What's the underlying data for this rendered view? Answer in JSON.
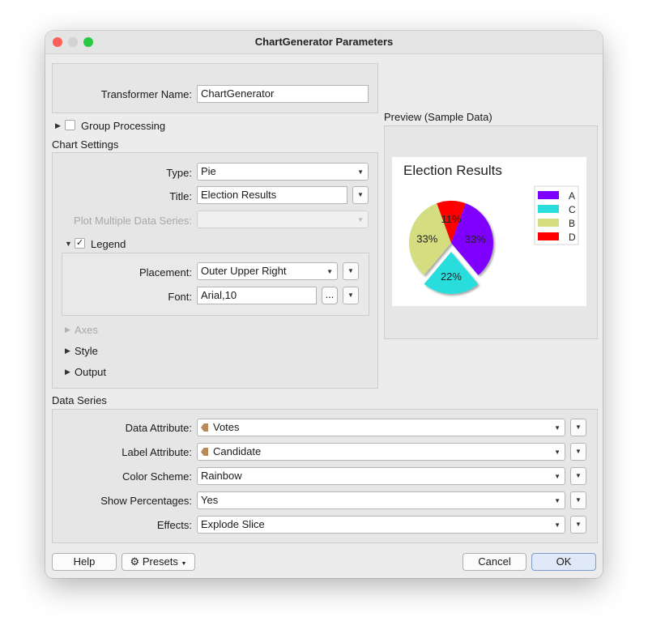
{
  "window": {
    "title": "ChartGenerator Parameters"
  },
  "transformer": {
    "label": "Transformer Name:",
    "value": "ChartGenerator"
  },
  "group_processing": {
    "label": "Group Processing",
    "checked": false
  },
  "chart_settings": {
    "title": "Chart Settings",
    "type": {
      "label": "Type:",
      "value": "Pie"
    },
    "chart_title": {
      "label": "Title:",
      "value": "Election Results"
    },
    "plot_multiple": {
      "label": "Plot Multiple Data Series:",
      "value": ""
    },
    "legend": {
      "label": "Legend",
      "checked": true,
      "placement": {
        "label": "Placement:",
        "value": "Outer Upper Right"
      },
      "font": {
        "label": "Font:",
        "value": "Arial,10",
        "browse": "..."
      }
    },
    "axes": "Axes",
    "style": "Style",
    "output": "Output"
  },
  "preview": {
    "title": "Preview (Sample Data)",
    "chart_data": {
      "type": "pie",
      "title": "Election Results",
      "categories": [
        "A",
        "C",
        "B",
        "D"
      ],
      "values": [
        33,
        22,
        33,
        11
      ],
      "labels": [
        "33%",
        "22%",
        "33%",
        "11%"
      ],
      "colors": [
        "#7f00ff",
        "#2adddd",
        "#d4dd80",
        "#ff0000"
      ],
      "exploded": "C",
      "legend_position": "upper-right"
    }
  },
  "data_series": {
    "title": "Data Series",
    "data_attribute": {
      "label": "Data Attribute:",
      "value": "Votes"
    },
    "label_attribute": {
      "label": "Label Attribute:",
      "value": "Candidate"
    },
    "color_scheme": {
      "label": "Color Scheme:",
      "value": "Rainbow"
    },
    "show_percentages": {
      "label": "Show Percentages:",
      "value": "Yes"
    },
    "effects": {
      "label": "Effects:",
      "value": "Explode Slice"
    }
  },
  "buttons": {
    "help": "Help",
    "presets": "Presets",
    "cancel": "Cancel",
    "ok": "OK"
  },
  "colors": {
    "close": "#fe5f57",
    "minimize": "#d2d2d2",
    "zoom": "#28c840",
    "ok_border": "#7e9cc9"
  },
  "icons": {
    "presets": "gear-icon",
    "expand": "triangle-right-icon",
    "collapse": "triangle-down-icon",
    "dropdown": "chevron-down-icon"
  }
}
